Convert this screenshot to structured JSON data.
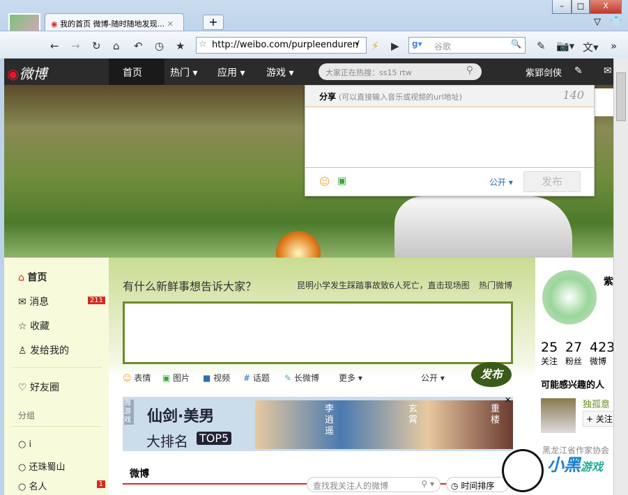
{
  "browser": {
    "tab_title": "我的首页 微博-随时随地发现...",
    "url": "http://weibo.com/purpleendurer/",
    "search_placeholder": "谷歌",
    "more": "»"
  },
  "nav": {
    "logo": "微博",
    "items": [
      "首页",
      "热门 ▾",
      "应用 ▾",
      "游戏 ▾"
    ],
    "search_placeholder": "大家正在热搜：ss15 rtw",
    "user": "紫郢剑侠"
  },
  "share": {
    "label": "分享",
    "hint": "(可以直接输入音乐或视频的url地址)",
    "count": "140",
    "visibility": "公开 ▾",
    "publish": "发布"
  },
  "sidebar": {
    "items": [
      {
        "label": "首页"
      },
      {
        "label": "消息",
        "badge": "211"
      },
      {
        "label": "收藏"
      },
      {
        "label": "发给我的"
      },
      {
        "label": "好友圈"
      }
    ],
    "group_title": "分组",
    "groups": [
      {
        "label": "i"
      },
      {
        "label": "还珠蜀山"
      },
      {
        "label": "名人",
        "badge": "1"
      }
    ]
  },
  "main": {
    "prompt": "有什么新鲜事想告诉大家？",
    "news": "昆明小学发生踩踏事故致6人死亡，直击现场图",
    "hot": "热门微博",
    "tools": [
      "表情",
      "图片",
      "视频",
      "话题",
      "长微博",
      "更多 ▾"
    ],
    "visibility": "公开 ▾",
    "publish": "发布",
    "ad": {
      "tag": "微游戏",
      "title": "仙剑·美男",
      "subtitle": "大排名",
      "top": "TOP5",
      "names": [
        "李逍遥",
        "玄霄",
        "重楼"
      ]
    },
    "feed_tab": "微博",
    "feed_search": "查找我关注人的微博",
    "sort": "时间排序"
  },
  "right": {
    "name": "紫",
    "stats": [
      {
        "n": "25",
        "l": "关注"
      },
      {
        "n": "27",
        "l": "粉丝"
      },
      {
        "n": "423",
        "l": "微博"
      }
    ],
    "interest_title": "可能感兴趣的人",
    "suggest": "独孤意",
    "follow": "+ 关注",
    "org": "黑龙江省作家协会"
  },
  "watermark": "小黑游戏 www.xiaohei.com"
}
